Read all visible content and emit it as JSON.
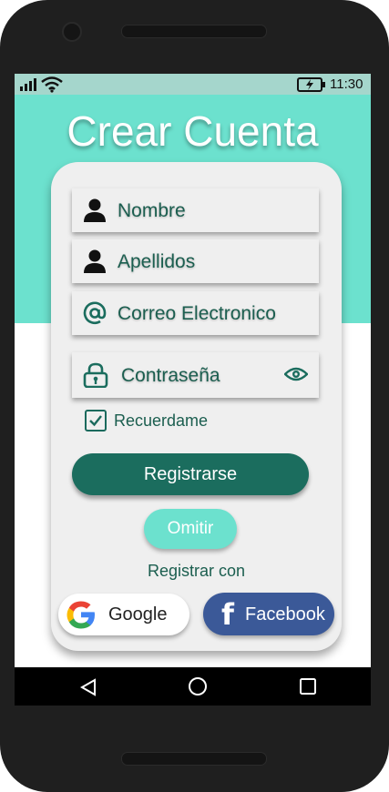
{
  "status_bar": {
    "time": "11:30"
  },
  "header": {
    "title": "Crear Cuenta"
  },
  "form": {
    "fields": [
      {
        "label": "Nombre",
        "icon": "person-icon"
      },
      {
        "label": "Apellidos",
        "icon": "person-icon"
      },
      {
        "label": "Correo Electronico",
        "icon": "at-icon"
      },
      {
        "label": "Contraseña",
        "icon": "lock-icon"
      }
    ],
    "remember_label": "Recuerdame",
    "remember_checked": true,
    "register_button": "Registrarse",
    "skip_button": "Omitir",
    "register_with": "Registrar con",
    "google_button": "Google",
    "facebook_button": "Facebook",
    "facebook_glyph": "f"
  },
  "colors": {
    "primary_dark": "#1b6d5e",
    "accent": "#6ce1ce",
    "facebook": "#3b5998",
    "card": "#efefef"
  }
}
